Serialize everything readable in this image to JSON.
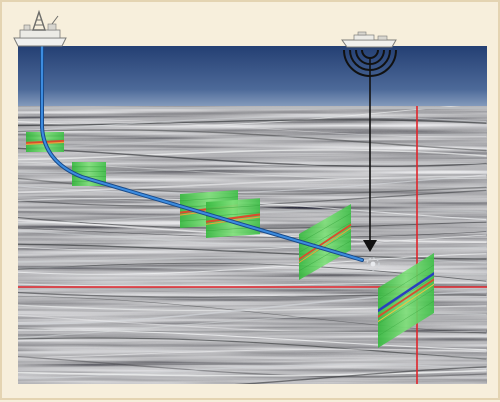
{
  "figure": {
    "subject": "seismic-cross-section",
    "colors": {
      "frame_background": "#f7efdc",
      "frame_border": "#e4d4b2",
      "water_top": "#243f73",
      "water_bottom": "#8aa0c0",
      "seismic_base": "#8b8d8f",
      "wellbore": "#2f74c9",
      "crosshair": "#e0242a",
      "panel_green": "#58d05a",
      "panel_band_red": "#d94d2e",
      "panel_band_blue": "#3050c8",
      "vessel": "#f0f0ee",
      "acoustic_signal": "#111111"
    },
    "icons": {
      "left_vessel": "drilling-platform-icon",
      "right_vessel": "seismic-vessel-icon",
      "signal": "acoustic-wave-icon",
      "source_arrow": "down-arrow-icon"
    },
    "labels": []
  }
}
